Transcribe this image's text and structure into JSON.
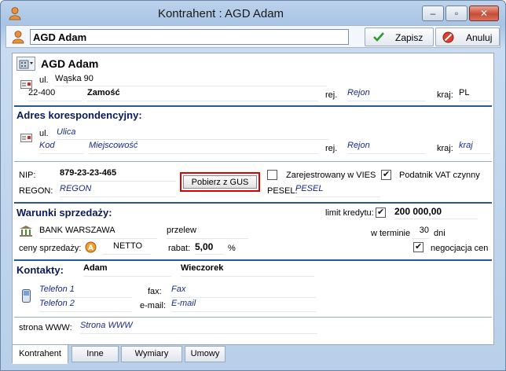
{
  "window": {
    "title": "Kontrahent : AGD Adam"
  },
  "toolbar": {
    "name_value": "AGD Adam",
    "save_label": "Zapisz",
    "cancel_label": "Anuluj"
  },
  "address": {
    "name": "AGD Adam",
    "street_label": "ul.",
    "street": "Wąska 90",
    "postal_code": "22-400",
    "city": "Zamość",
    "rej_label": "rej.",
    "rej_placeholder": "Rejon",
    "kraj_label": "kraj:",
    "kraj": "PL"
  },
  "corr": {
    "title": "Adres korespondencyjny:",
    "street_label": "ul.",
    "street_placeholder": "Ulica",
    "postal_placeholder": "Kod",
    "city_placeholder": "Miejscowość",
    "rej_label": "rej.",
    "rej_placeholder": "Rejon",
    "kraj_label": "kraj:",
    "kraj_placeholder": "kraj"
  },
  "ids": {
    "nip_label": "NIP:",
    "nip": "879-23-23-465",
    "regon_label": "REGON:",
    "regon_placeholder": "REGON",
    "gus_button": "Pobierz z GUS",
    "vies_label": "Zarejestrowany w VIES",
    "vat_label": "Podatnik VAT czynny",
    "pesel_label": "PESEL:",
    "pesel_placeholder": "PESEL"
  },
  "sales": {
    "title": "Warunki sprzedaży:",
    "credit_label": "limit kredytu:",
    "credit_value": "200 000,00",
    "bank": "BANK WARSZAWA",
    "payment": "przelew",
    "term_label": "w terminie",
    "term_days": "30",
    "days_label": "dni",
    "prices_label": "ceny sprzedaży:",
    "prices_value": "NETTO",
    "discount_label": "rabat:",
    "discount_value": "5,00",
    "percent": "%",
    "negotiation_label": "negocjacja cen"
  },
  "contacts": {
    "title": "Kontakty:",
    "first_name": "Adam",
    "last_name": "Wieczorek",
    "phone1_placeholder": "Telefon 1",
    "phone2_placeholder": "Telefon 2",
    "fax_label": "fax:",
    "fax_placeholder": "Fax",
    "email_label": "e-mail:",
    "email_placeholder": "E-mail"
  },
  "www": {
    "label": "strona WWW:",
    "placeholder": "Strona WWW"
  },
  "tabs": [
    {
      "label": "Kontrahent"
    },
    {
      "label": "Inne"
    },
    {
      "label": "Wymiary"
    },
    {
      "label": "Umowy"
    }
  ],
  "checks": {
    "vies": false,
    "vat": true,
    "credit": true,
    "negotiation": true
  },
  "colors": {
    "accent": "#2b5797",
    "highlight": "#e00000"
  }
}
